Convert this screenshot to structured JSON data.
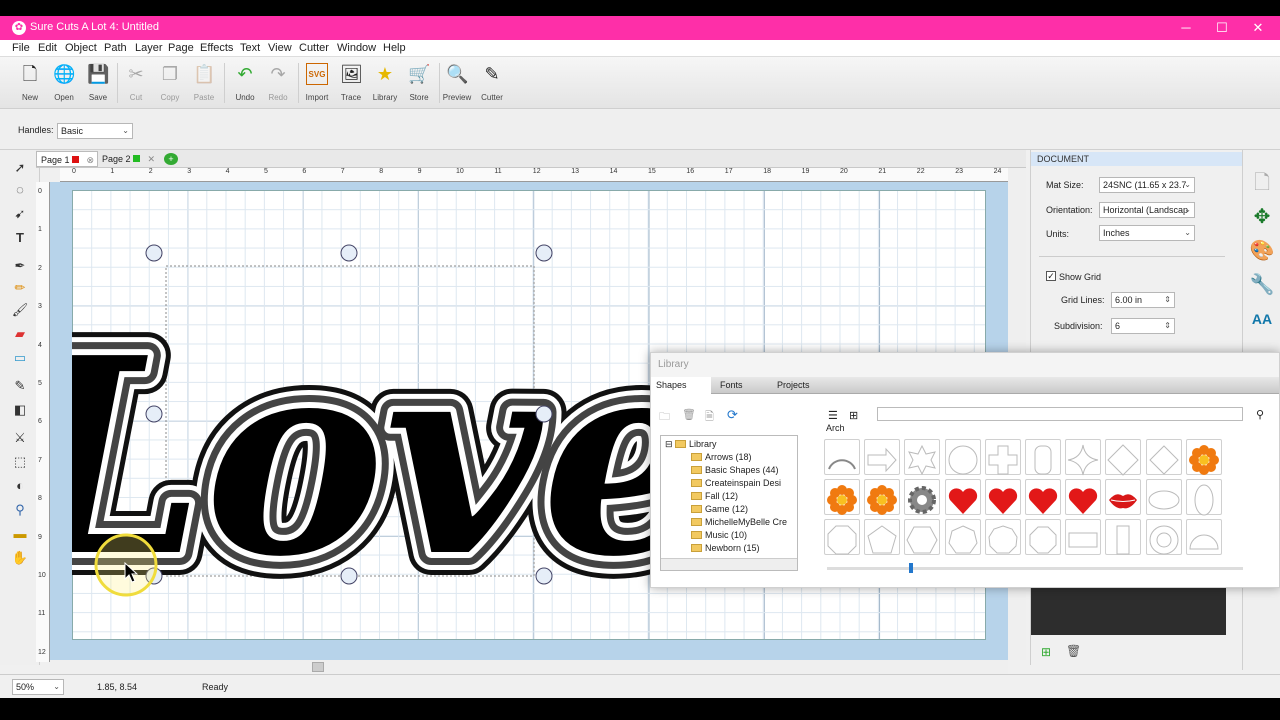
{
  "window": {
    "title": "Sure Cuts A Lot 4: Untitled",
    "minimize": "─",
    "maximize": "☐",
    "close": "✕"
  },
  "menu": [
    "File",
    "Edit",
    "Object",
    "Path",
    "Layer",
    "Page",
    "Effects",
    "Text",
    "View",
    "Cutter",
    "Window",
    "Help"
  ],
  "toolbar": [
    {
      "label": "New",
      "icon": "🗋",
      "enabled": true
    },
    {
      "label": "Open",
      "icon": "🌐",
      "enabled": true
    },
    {
      "label": "Save",
      "icon": "💾",
      "enabled": true
    },
    {
      "label": "Cut",
      "icon": "✂",
      "enabled": false
    },
    {
      "label": "Copy",
      "icon": "❐",
      "enabled": false
    },
    {
      "label": "Paste",
      "icon": "📋",
      "enabled": false
    },
    {
      "label": "Undo",
      "icon": "↶",
      "enabled": true
    },
    {
      "label": "Redo",
      "icon": "↷",
      "enabled": false
    },
    {
      "label": "Import",
      "icon": "SVG",
      "enabled": true
    },
    {
      "label": "Trace",
      "icon": "🖼",
      "enabled": true
    },
    {
      "label": "Library",
      "icon": "★",
      "enabled": true
    },
    {
      "label": "Store",
      "icon": "🛒",
      "enabled": true
    },
    {
      "label": "Preview",
      "icon": "🔍",
      "enabled": true
    },
    {
      "label": "Cutter",
      "icon": "✎",
      "enabled": true
    }
  ],
  "handles": {
    "label": "Handles:",
    "value": "Basic"
  },
  "pages": [
    {
      "label": "Page 1",
      "color": "#d11"
    },
    {
      "label": "Page 2",
      "color": "#2b2"
    }
  ],
  "ruler": {
    "h": [
      "0",
      "1",
      "2",
      "3",
      "4",
      "5",
      "6",
      "7",
      "8",
      "9",
      "10",
      "11",
      "12",
      "13",
      "14",
      "15",
      "16",
      "17",
      "18",
      "19",
      "20",
      "21",
      "22",
      "23",
      "24"
    ],
    "v": [
      "0",
      "1",
      "2",
      "3",
      "4",
      "5",
      "6",
      "7",
      "8",
      "9",
      "10",
      "11",
      "12"
    ]
  },
  "canvas": {
    "text": "Love"
  },
  "document": {
    "header": "DOCUMENT",
    "mat_size_label": "Mat Size:",
    "mat_size": "24SNC (11.65 x 23.7",
    "orientation_label": "Orientation:",
    "orientation": "Horizontal (Landscap",
    "units_label": "Units:",
    "units": "Inches",
    "show_grid": "Show Grid",
    "grid_lines_label": "Grid Lines:",
    "grid_lines": "6.00 in",
    "subdivision_label": "Subdivision:",
    "subdivision": "6"
  },
  "library": {
    "title": "Library",
    "tabs": [
      "Shapes",
      "Fonts",
      "Projects"
    ],
    "search_placeholder": "",
    "category": "Arch",
    "tree": [
      "Library",
      "Arrows (18)",
      "Basic Shapes (44)",
      "Createinspain Desi",
      "Fall (12)",
      "Game (12)",
      "MichelleMyBelle Cre",
      "Music (10)",
      "Newborn (15)"
    ],
    "shapes": [
      "arch",
      "arrow",
      "cross-star",
      "circle",
      "plus",
      "rounded-rect",
      "four-star",
      "diamond",
      "diamond2",
      "orange-flower",
      "orange-flower",
      "orange-flower",
      "gear",
      "heart",
      "heart",
      "heart",
      "heart",
      "lips",
      "ellipse",
      "tall-ellipse",
      "octagon",
      "pentagon",
      "hexagon",
      "heptagon",
      "nonagon",
      "octagon2",
      "rect",
      "tall-rect",
      "ring",
      "dome"
    ]
  },
  "status": {
    "zoom": "50%",
    "coords": "1.85, 8.54",
    "state": "Ready"
  }
}
